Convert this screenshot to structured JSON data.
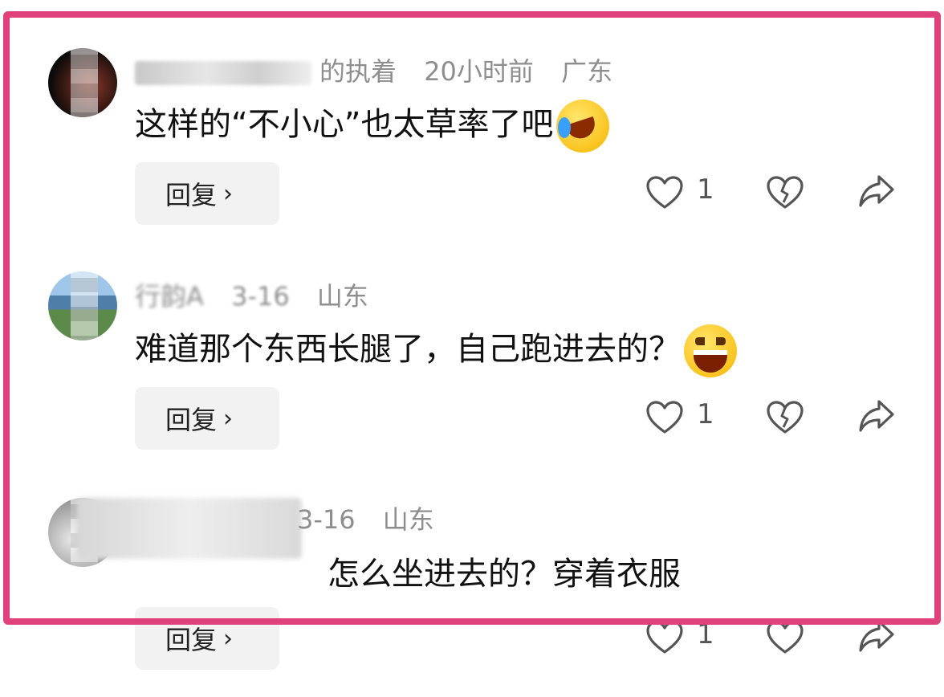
{
  "comments": [
    {
      "name_visible": "的执着",
      "time": "20小时前",
      "location": "广东",
      "text": "这样的“不小心”也太草率了吧",
      "emoji": "rolling-on-floor-laughing",
      "reply_label": "回复",
      "like_count": "1"
    },
    {
      "name_visible": "行韵A",
      "time": "3-16",
      "location": "山东",
      "text": "难道那个东西长腿了，自己跑进去的？",
      "emoji": "grinning-squinting-face",
      "reply_label": "回复",
      "like_count": "1"
    },
    {
      "name_visible": "",
      "time": "3-16",
      "location": "山东",
      "text": "怎么坐进去的？穿着衣服",
      "emoji": "",
      "reply_label": "回复",
      "like_count": "1"
    }
  ],
  "icons": {
    "like": "heart-outline-icon",
    "dislike": "broken-heart-icon",
    "share": "share-arrow-icon"
  },
  "colors": {
    "frame": "#e0417a",
    "meta_text": "#8e8e8e",
    "button_bg": "#f2f2f2"
  }
}
